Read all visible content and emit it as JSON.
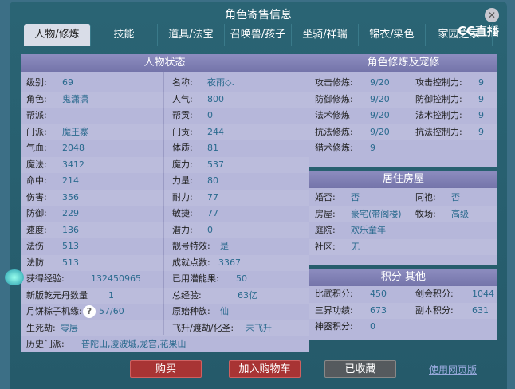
{
  "window": {
    "title": "角色寄售信息",
    "logo": "CC直播"
  },
  "tabs": [
    "人物/修炼",
    "技能",
    "道具/法宝",
    "召唤兽/孩子",
    "坐骑/祥瑞",
    "锦衣/染色",
    "家园之家"
  ],
  "status": {
    "header": "人物状态",
    "rows": [
      [
        {
          "l": "级别:",
          "v": "69"
        },
        {
          "l": "名称:",
          "v": "夜雨◇."
        }
      ],
      [
        {
          "l": "角色:",
          "v": "鬼潇潇"
        },
        {
          "l": "人气:",
          "v": "800"
        }
      ],
      [
        {
          "l": "帮派:",
          "v": ""
        },
        {
          "l": "帮贡:",
          "v": "0"
        }
      ],
      [
        {
          "l": "门派:",
          "v": "魔王寨"
        },
        {
          "l": "门贡:",
          "v": "244"
        }
      ],
      [
        {
          "l": "气血:",
          "v": "2048"
        },
        {
          "l": "体质:",
          "v": "81"
        }
      ],
      [
        {
          "l": "魔法:",
          "v": "3412"
        },
        {
          "l": "魔力:",
          "v": "537"
        }
      ],
      [
        {
          "l": "命中:",
          "v": "214"
        },
        {
          "l": "力量:",
          "v": "80"
        }
      ],
      [
        {
          "l": "伤害:",
          "v": "356"
        },
        {
          "l": "耐力:",
          "v": "77"
        }
      ],
      [
        {
          "l": "防御:",
          "v": "229"
        },
        {
          "l": "敏捷:",
          "v": "77"
        }
      ],
      [
        {
          "l": "速度:",
          "v": "136"
        },
        {
          "l": "潜力:",
          "v": "0"
        }
      ],
      [
        {
          "l": "法伤",
          "v": "513"
        },
        {
          "l": "靓号特效:",
          "v": "是"
        }
      ],
      [
        {
          "l": "法防",
          "v": "513"
        },
        {
          "l": "成就点数:",
          "v": "3367"
        }
      ],
      [
        {
          "l": "获得经验:",
          "v": "132450965"
        },
        {
          "l": "已用潜能果:",
          "v": "50"
        }
      ],
      [
        {
          "l": "新版乾元丹数量",
          "v": "1"
        },
        {
          "l": "总经验:",
          "v": "63亿"
        }
      ],
      [
        {
          "l": "月饼粽子机缘:",
          "v": "57/60"
        },
        {
          "l": "原始种族:",
          "v": "仙"
        }
      ],
      [
        {
          "l": "生死劫:",
          "v": "零层"
        },
        {
          "l": "飞升/渡劫/化圣:",
          "v": "未飞升"
        }
      ],
      [
        {
          "l": "历史门派:",
          "v": "普陀山,凌波城,龙宫,花果山"
        }
      ]
    ],
    "help_icon": "?"
  },
  "cultivation": {
    "header": "角色修炼及宠修",
    "rows": [
      [
        {
          "l": "攻击修炼:",
          "v": "9/20"
        },
        {
          "l": "攻击控制力:",
          "v": "9"
        }
      ],
      [
        {
          "l": "防御修炼:",
          "v": "9/20"
        },
        {
          "l": "防御控制力:",
          "v": "9"
        }
      ],
      [
        {
          "l": "法术修炼",
          "v": "9/20"
        },
        {
          "l": "法术控制力:",
          "v": "9"
        }
      ],
      [
        {
          "l": "抗法修炼:",
          "v": "9/20"
        },
        {
          "l": "抗法控制力:",
          "v": "9"
        }
      ],
      [
        {
          "l": "猎术修炼:",
          "v": "9"
        }
      ]
    ]
  },
  "house": {
    "header": "居住房屋",
    "rows": [
      [
        {
          "l": "婚否:",
          "v": "否"
        },
        {
          "l": "同袍:",
          "v": "否"
        }
      ],
      [
        {
          "l": "房屋:",
          "v": "豪宅(带阁楼)"
        },
        {
          "l": "牧场:",
          "v": "高级"
        }
      ],
      [
        {
          "l": "庭院:",
          "v": "欢乐童年"
        }
      ],
      [
        {
          "l": "社区:",
          "v": "无"
        }
      ]
    ]
  },
  "points": {
    "header": "积分 其他",
    "rows": [
      [
        {
          "l": "比武积分:",
          "v": "450"
        },
        {
          "l": "剑会积分:",
          "v": "1044"
        }
      ],
      [
        {
          "l": "三界功绩:",
          "v": "673"
        },
        {
          "l": "副本积分:",
          "v": "631"
        }
      ],
      [
        {
          "l": "神器积分:",
          "v": "0"
        }
      ]
    ]
  },
  "buttons": {
    "buy": "购买",
    "add_cart": "加入购物车",
    "favorited": "已收藏",
    "web": "使用网页版"
  }
}
